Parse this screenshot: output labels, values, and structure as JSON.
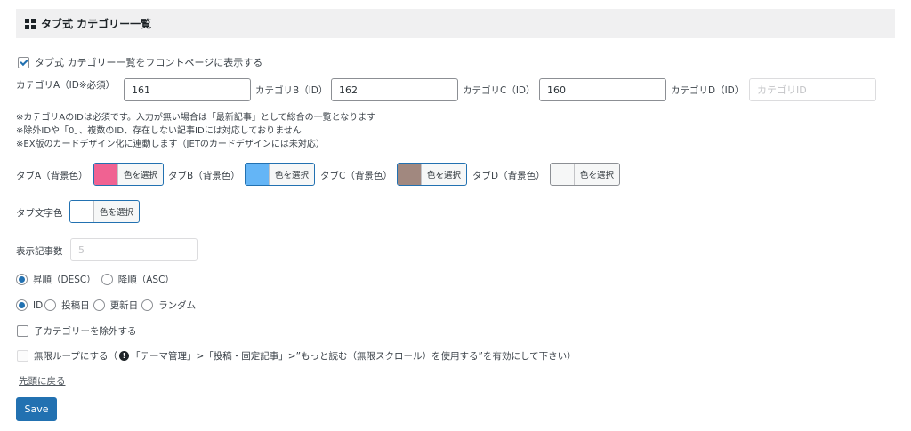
{
  "header": {
    "title": "タブ式 カテゴリー一覧"
  },
  "show_front": {
    "label": "タブ式 カテゴリー一覧をフロントページに表示する",
    "checked": true
  },
  "categories": {
    "a": {
      "label": "カテゴリA（ID※必須）",
      "value": "161"
    },
    "b": {
      "label": "カテゴリB（ID）",
      "value": "162"
    },
    "c": {
      "label": "カテゴリC（ID）",
      "value": "160"
    },
    "d": {
      "label": "カテゴリD（ID）",
      "value": "",
      "placeholder": "カテゴリID"
    }
  },
  "notes": [
    "※カテゴリAのIDは必須です。入力が無い場合は「最新記事」として総合の一覧となります",
    "※除外IDや「0」、複数のID、存在しない記事IDには対応しておりません",
    "※EX版のカードデザイン化に連動します（JETのカードデザインには未対応）"
  ],
  "tab_colors": {
    "select_label": "色を選択",
    "a": {
      "label": "タブA（背景色）",
      "color": "#f06292"
    },
    "b": {
      "label": "タブB（背景色）",
      "color": "#64b5f6"
    },
    "c": {
      "label": "タブC（背景色）",
      "color": "#a1887f"
    },
    "d": {
      "label": "タブD（背景色）",
      "color": "#f6f7f7"
    },
    "text": {
      "label": "タブ文字色",
      "color": "#ffffff"
    }
  },
  "post_count": {
    "label": "表示記事数",
    "placeholder": "5"
  },
  "order": {
    "desc": {
      "label": "昇順（DESC）",
      "checked": true
    },
    "asc": {
      "label": "降順（ASC）",
      "checked": false
    }
  },
  "sort_by": {
    "id": {
      "label": "ID",
      "checked": true
    },
    "date": {
      "label": "投稿日",
      "checked": false
    },
    "modified": {
      "label": "更新日",
      "checked": false
    },
    "random": {
      "label": "ランダム",
      "checked": false
    }
  },
  "exclude_children": {
    "label": "子カテゴリーを除外する",
    "checked": false
  },
  "infinite_loop": {
    "label_prefix": "無限ループにする（",
    "label_rest": "「テーマ管理」>「投稿・固定記事」>”もっと読む（無限スクロール）を使用する”を有効にして下さい）",
    "disabled": true
  },
  "back_to_top": {
    "label": "先頭に戻る"
  },
  "save": {
    "label": "Save"
  },
  "colors": {
    "accent": "#2271b1",
    "header_bg": "#f0f0f1"
  }
}
